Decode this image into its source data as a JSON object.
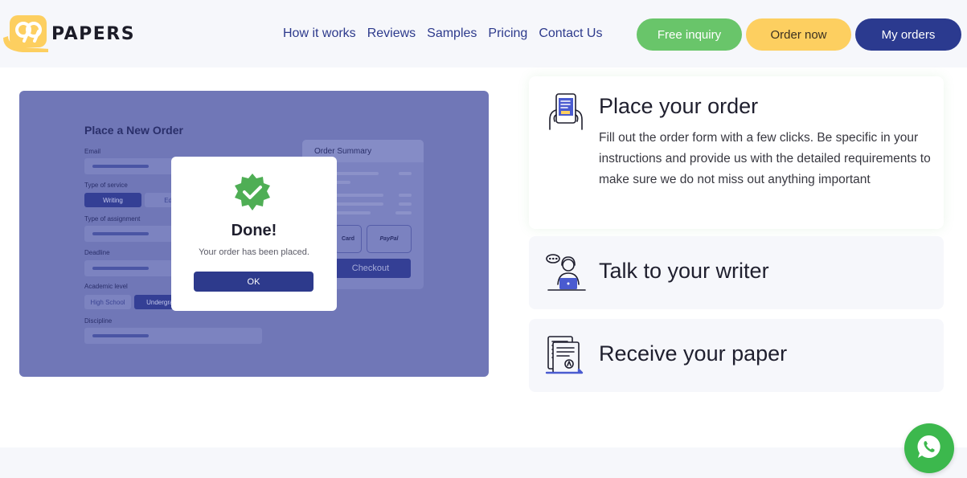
{
  "brand": {
    "name": "PAPERS",
    "accent": "#fdcf60",
    "primary": "#2b3a8f"
  },
  "nav": {
    "items": [
      {
        "label": "How it works"
      },
      {
        "label": "Reviews"
      },
      {
        "label": "Samples"
      },
      {
        "label": "Pricing"
      },
      {
        "label": "Contact Us"
      }
    ]
  },
  "header_buttons": {
    "free_inquiry": "Free inquiry",
    "order_now": "Order now",
    "my_orders": "My orders"
  },
  "illustration": {
    "form_title": "Place a New Order",
    "email_label": "Email",
    "service_label": "Type of service",
    "service_options": [
      "Writing",
      "Edi"
    ],
    "assignment_label": "Type of assignment",
    "deadline_label": "Deadline",
    "academic_label": "Academic level",
    "academic_options": [
      "High School",
      "Undergrad"
    ],
    "discipline_label": "Discipline",
    "summary_title": "Order Summary",
    "pay_card": "Card",
    "pay_paypal": "PayPal",
    "checkout": "Checkout",
    "modal": {
      "title": "Done!",
      "message": "Your order has been placed.",
      "ok": "OK"
    }
  },
  "steps": [
    {
      "title": "Place your order",
      "icon": "tablet-order-icon",
      "description": "Fill out the order form with a few clicks. Be specific in your instructions and provide us with the detailed requirements to make sure we do not miss out anything important"
    },
    {
      "title": "Talk to your writer",
      "icon": "writer-chat-icon"
    },
    {
      "title": "Receive your paper",
      "icon": "paper-document-icon"
    }
  ],
  "chat": {
    "icon": "whatsapp-icon",
    "color": "#3cb84d"
  }
}
